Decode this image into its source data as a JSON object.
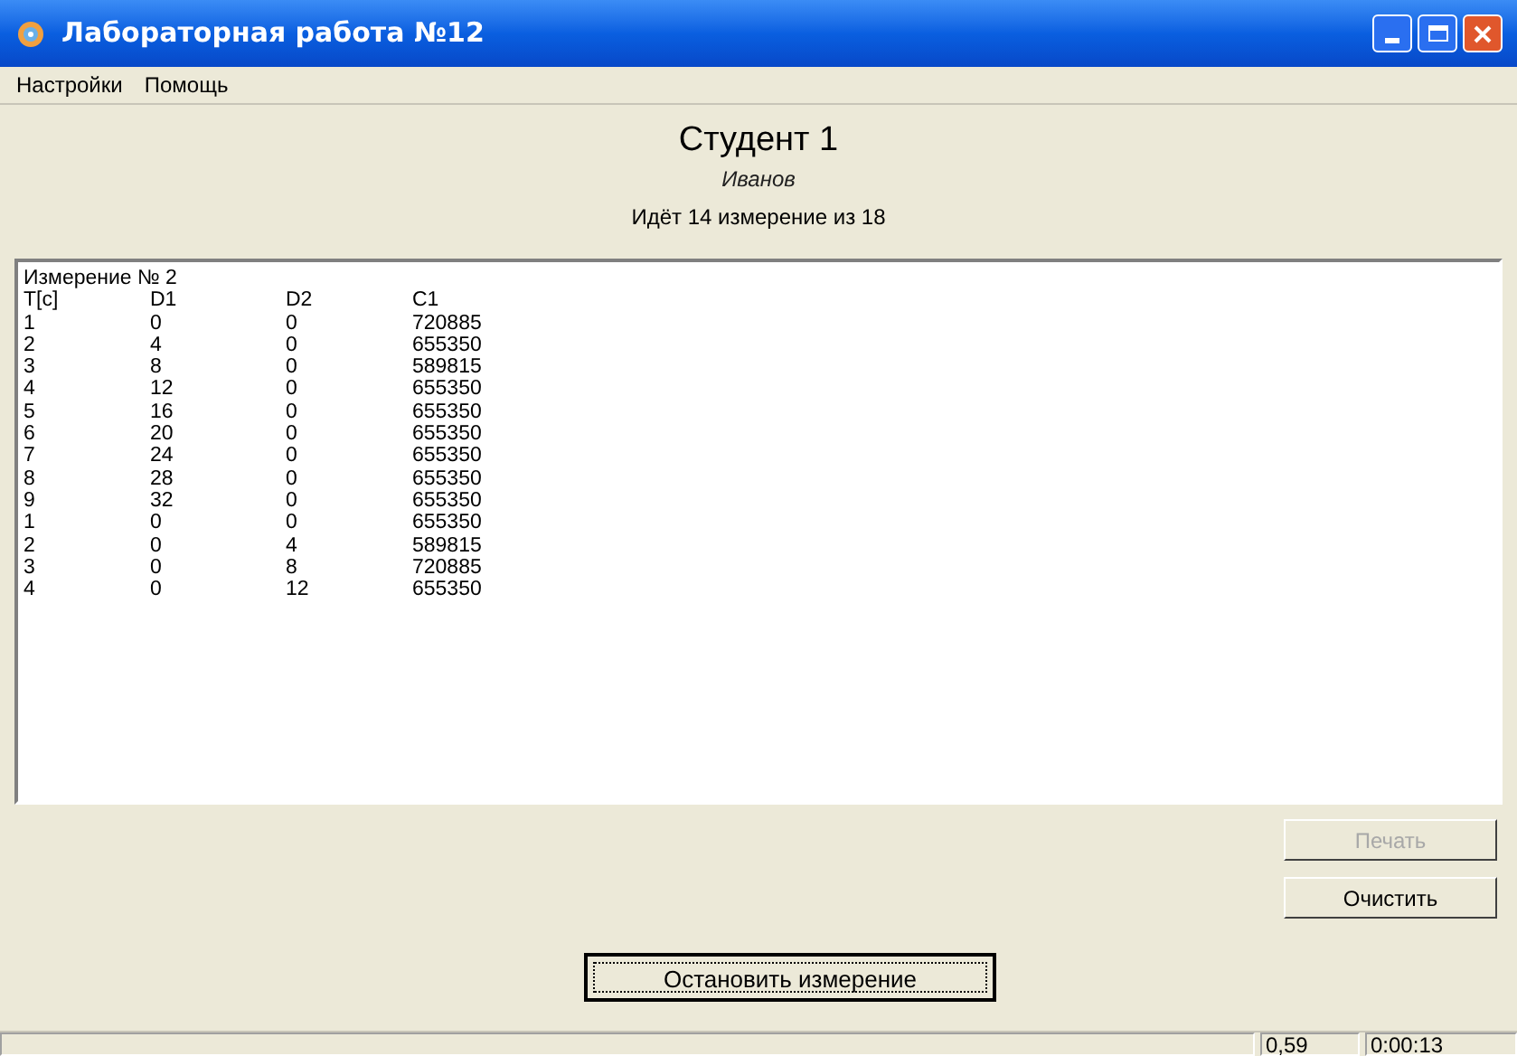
{
  "window": {
    "title": "Лабораторная работа №12"
  },
  "menu": [
    "Настройки",
    "Помощь"
  ],
  "heading": {
    "student": "Студент 1",
    "surname": "Иванов",
    "progress": "Идёт 14 измерение из 18"
  },
  "log": {
    "title": "Измерение № 2",
    "columns": [
      "T[c]",
      "D1",
      "D2",
      "C1"
    ],
    "rows": [
      [
        "1",
        "0",
        "0",
        "720885"
      ],
      [
        "2",
        "4",
        "0",
        "655350"
      ],
      [
        "3",
        "8",
        "0",
        "589815"
      ],
      [
        "4",
        "12",
        "0",
        "655350"
      ],
      [
        "5",
        "16",
        "0",
        "655350"
      ],
      [
        "6",
        "20",
        "0",
        "655350"
      ],
      [
        "7",
        "24",
        "0",
        "655350"
      ],
      [
        "8",
        "28",
        "0",
        "655350"
      ],
      [
        "9",
        "32",
        "0",
        "655350"
      ],
      [
        "1",
        "0",
        "0",
        "655350"
      ],
      [
        "2",
        "0",
        "4",
        "589815"
      ],
      [
        "3",
        "0",
        "8",
        "720885"
      ],
      [
        "4",
        "0",
        "12",
        "655350"
      ]
    ]
  },
  "side_buttons": [
    {
      "label": "Печать",
      "disabled": true
    },
    {
      "label": "Очистить",
      "disabled": false
    }
  ],
  "stop_button": {
    "label": "Остановить измерение",
    "focused": true
  },
  "status_bar": [
    "0,59",
    "0:00:13"
  ]
}
